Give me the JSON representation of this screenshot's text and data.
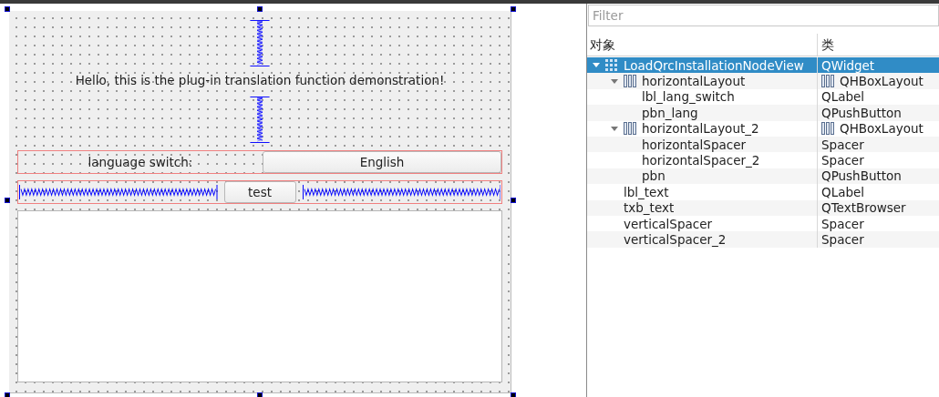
{
  "form": {
    "title_label": "Hello, this is the plug-in translation function demonstration!",
    "lang_label": "language switch:",
    "lang_button": "English",
    "test_button": "test"
  },
  "object_inspector": {
    "filter": {
      "placeholder": "Filter"
    },
    "columns": [
      "对象",
      "类"
    ],
    "items": [
      {
        "name": "LoadQrcInstallationNodeView",
        "class": "QWidget",
        "kind": "widget",
        "selected": true,
        "expanded": true,
        "children": [
          {
            "name": "horizontalLayout",
            "class": "QHBoxLayout",
            "kind": "layout",
            "selected": false,
            "expanded": true,
            "children": [
              {
                "name": "lbl_lang_switch",
                "class": "QLabel",
                "selected": false
              },
              {
                "name": "pbn_lang",
                "class": "QPushButton",
                "selected": false
              }
            ]
          },
          {
            "name": "horizontalLayout_2",
            "class": "QHBoxLayout",
            "kind": "layout",
            "selected": false,
            "expanded": true,
            "children": [
              {
                "name": "horizontalSpacer",
                "class": "Spacer",
                "selected": false
              },
              {
                "name": "horizontalSpacer_2",
                "class": "Spacer",
                "selected": false
              },
              {
                "name": "pbn",
                "class": "QPushButton",
                "selected": false
              }
            ]
          },
          {
            "name": "lbl_text",
            "class": "QLabel",
            "selected": false
          },
          {
            "name": "txb_text",
            "class": "QTextBrowser",
            "selected": false
          },
          {
            "name": "verticalSpacer",
            "class": "Spacer",
            "selected": false
          },
          {
            "name": "verticalSpacer_2",
            "class": "Spacer",
            "selected": false
          }
        ]
      }
    ]
  }
}
